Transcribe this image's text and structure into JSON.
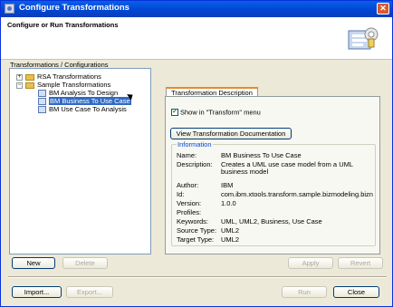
{
  "window": {
    "title": "Configure Transformations"
  },
  "banner": {
    "title": "Configure or Run Transformations"
  },
  "tree": {
    "section_label": "Transformations / Configurations",
    "items": [
      {
        "label": "RSA Transformations",
        "expander": "+"
      },
      {
        "label": "Sample Transformations",
        "expander": "−"
      },
      {
        "label": "BM Analysis To Design"
      },
      {
        "label": "BM Business To Use Case",
        "selected": true
      },
      {
        "label": "BM Use Case To Analysis"
      }
    ]
  },
  "buttons": {
    "new": "New",
    "delete": "Delete",
    "apply": "Apply",
    "revert": "Revert",
    "import": "Import...",
    "export": "Export...",
    "run": "Run",
    "close": "Close"
  },
  "details": {
    "tab": "Transformation Description",
    "show_in_menu": "Show in \"Transform\" menu",
    "show_in_menu_checked": true,
    "view_doc_button": "View Transformation Documentation",
    "info_title": "Information",
    "fields": [
      {
        "key": "Name:",
        "value": "BM Business To Use Case"
      },
      {
        "key": "Description:",
        "value": "Creates a UML use case model from a UML"
      },
      {
        "key": "",
        "value": "business model"
      },
      {
        "key": "Author:",
        "value": "IBM"
      },
      {
        "key": "Id:",
        "value": "com.ibm.xtools.transform.sample.bizmodeling.bizn"
      },
      {
        "key": "Version:",
        "value": "1.0.0"
      },
      {
        "key": "Profiles:",
        "value": ""
      },
      {
        "key": "Keywords:",
        "value": "UML, UML2, Business, Use Case"
      },
      {
        "key": "Source Type:",
        "value": "UML2"
      },
      {
        "key": "Target Type:",
        "value": "UML2"
      }
    ]
  },
  "colors": {
    "titlebar": "#0047d4",
    "selection": "#316ac5",
    "tab_accent": "#e68b2c"
  }
}
